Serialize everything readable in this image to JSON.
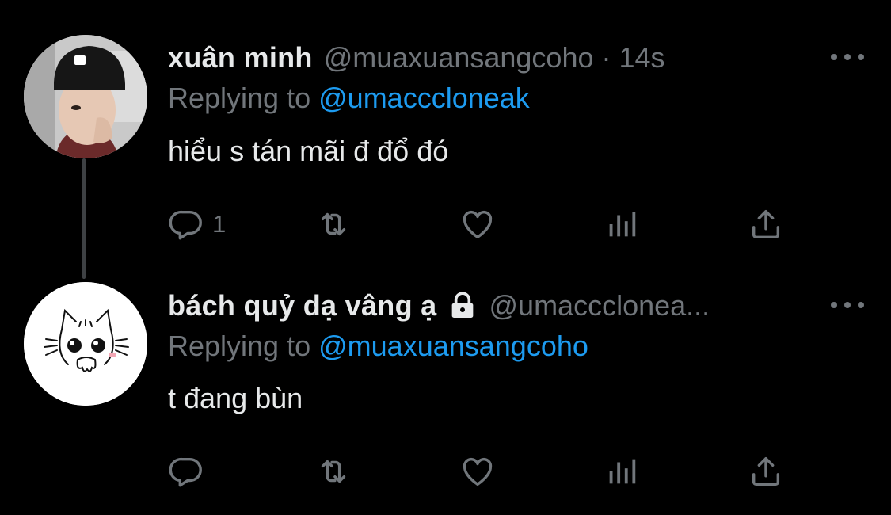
{
  "tweets": [
    {
      "display_name": "xuân minh",
      "handle": "@muaxuansangcoho",
      "separator": "·",
      "time": "14s",
      "replying_prefix": "Replying to",
      "replying_to": "@umacccloneak",
      "text": "hiểu s tán mãi đ đổ đó",
      "reply_count": "1",
      "avatar_icon": "person-photo-avatar"
    },
    {
      "display_name": "bách quỷ dạ vâng ạ",
      "handle": "@umacccloneа...",
      "replying_prefix": "Replying to",
      "replying_to": "@muaxuansangcoho",
      "text": "t đang bùn",
      "reply_count": "",
      "avatar_icon": "cat-sticker-avatar",
      "protected_icon": "lock-icon"
    }
  ],
  "colors": {
    "background": "#000000",
    "text": "#e7e9ea",
    "muted": "#71767b",
    "link": "#1d9bf0",
    "thread_line": "#3e4144"
  }
}
